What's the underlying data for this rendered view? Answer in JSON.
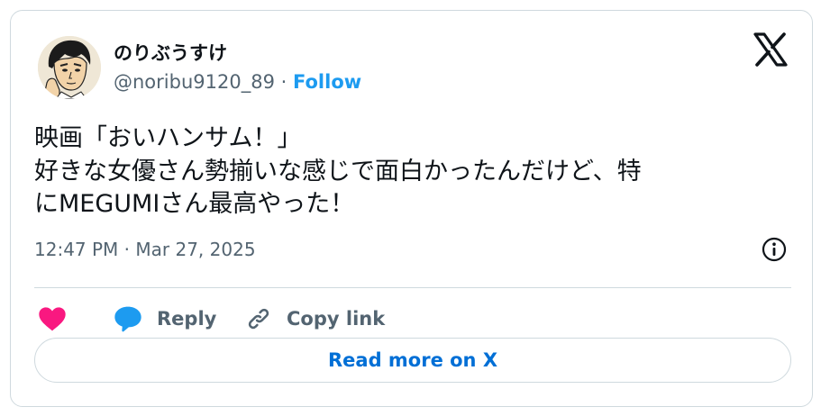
{
  "tweet": {
    "display_name": "のりぶうすけ",
    "handle": "@noribu9120_89",
    "separator": "·",
    "follow_label": "Follow",
    "text_lines": [
      "映画「おいハンサム！」",
      "好きな女優さん勢揃いな感じで面白かったんだけど、特",
      "にMEGUMIさん最高やった！"
    ],
    "timestamp": "12:47 PM · Mar 27, 2025"
  },
  "actions": {
    "reply_label": "Reply",
    "copy_link_label": "Copy link"
  },
  "footer": {
    "read_more_label": "Read more on X"
  },
  "icons": {
    "logo": "x-logo-icon",
    "info": "info-icon",
    "like": "heart-icon",
    "reply": "speech-bubble-icon",
    "copy": "link-icon"
  },
  "colors": {
    "follow": "#1d9bf0",
    "heart": "#f91880",
    "reply_bubble": "#1d9bf0",
    "read_more": "#006fd6",
    "muted": "#536471",
    "border": "#cfd9de"
  }
}
